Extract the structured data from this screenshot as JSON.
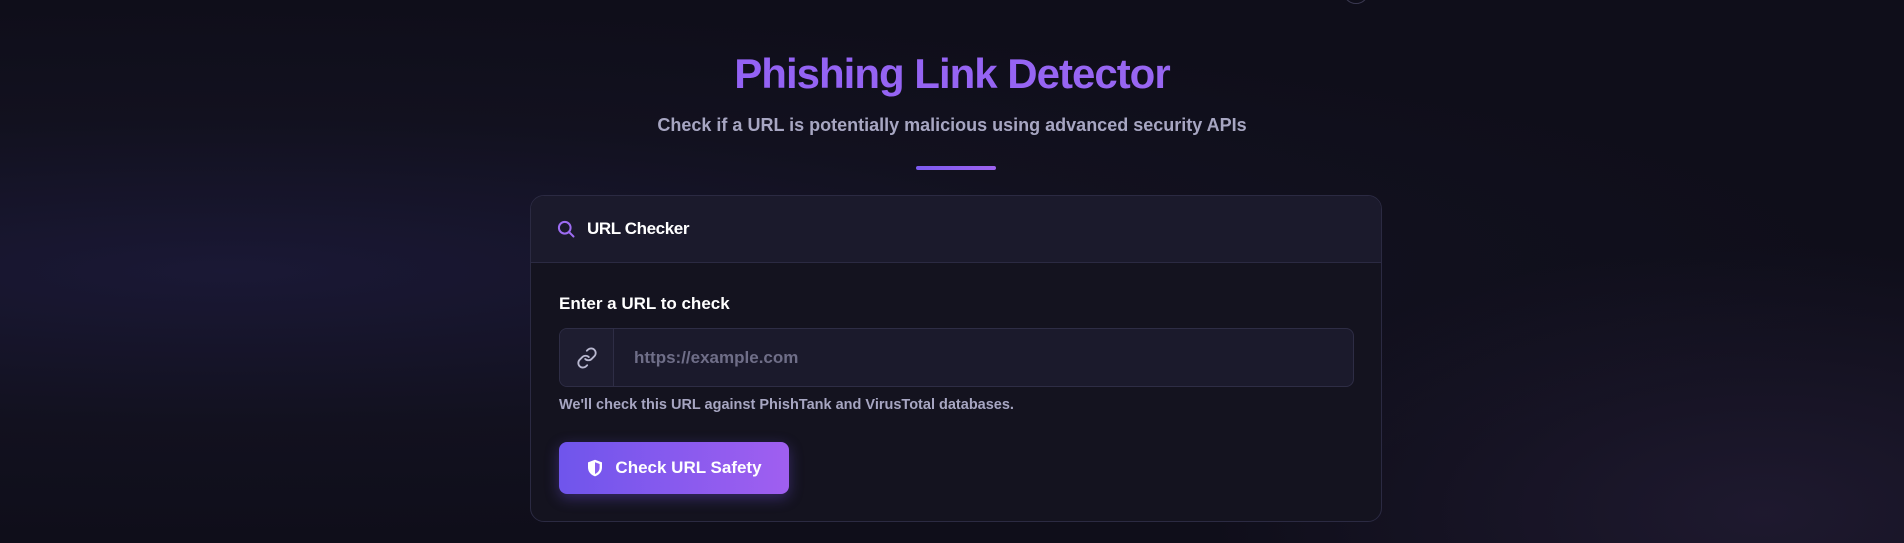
{
  "header": {
    "title": "Phishing Link Detector",
    "subtitle": "Check if a URL is potentially malicious using advanced security APIs"
  },
  "card": {
    "title": "URL Checker",
    "title_icon": "search-icon",
    "field_label": "Enter a URL to check",
    "input": {
      "value": "",
      "placeholder": "https://example.com",
      "prefix_icon": "link-icon"
    },
    "help_text": "We'll check this URL against PhishTank and VirusTotal databases.",
    "submit_button": {
      "label": "Check URL Safety",
      "icon": "shield-icon"
    }
  },
  "colors": {
    "accent": "#8b5cf6",
    "accent_end": "#a05ff0",
    "background": "#100f1b",
    "card_background": "#14131f",
    "card_header_background": "#1b1a2c",
    "muted_text": "#a7a6c2"
  }
}
